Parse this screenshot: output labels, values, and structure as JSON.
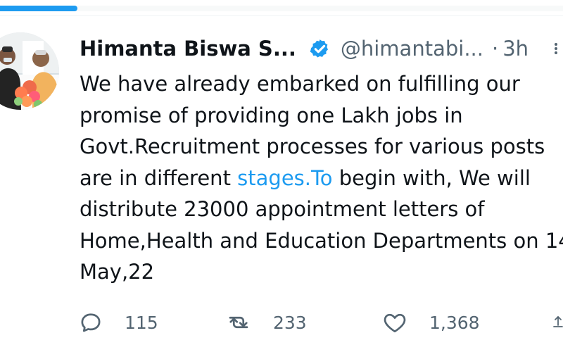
{
  "progress": {
    "percent": 13.8,
    "color": "#1d9bf0"
  },
  "tweet": {
    "author": {
      "display_name": "Himanta Biswa S...",
      "handle": "@himantabi...",
      "verified": true,
      "avatar_icon": "profile-photo"
    },
    "separator": "·",
    "timestamp": "3h",
    "body": {
      "line1": "We have already embarked on fulfilling our",
      "line2": "promise of providing one Lakh jobs in",
      "line3": "Govt.Recruitment processes for various posts",
      "line4_before": "are in different ",
      "line4_link": "stages.To",
      "line4_after": " begin with, We will",
      "line5": "distribute 23000 appointment letters of",
      "line6": "Home,Health and Education Departments on 14",
      "line7": "May,22"
    },
    "actions": {
      "reply_count": "115",
      "retweet_count": "233",
      "like_count": "1,368"
    }
  },
  "colors": {
    "text": "#0f1419",
    "secondary": "#536471",
    "link": "#1d9bf0",
    "verified": "#1d9bf0"
  },
  "icons": {
    "more": "more-icon",
    "reply": "reply-icon",
    "retweet": "retweet-icon",
    "like": "heart-icon",
    "share": "share-icon",
    "verified": "verified-badge-icon"
  }
}
